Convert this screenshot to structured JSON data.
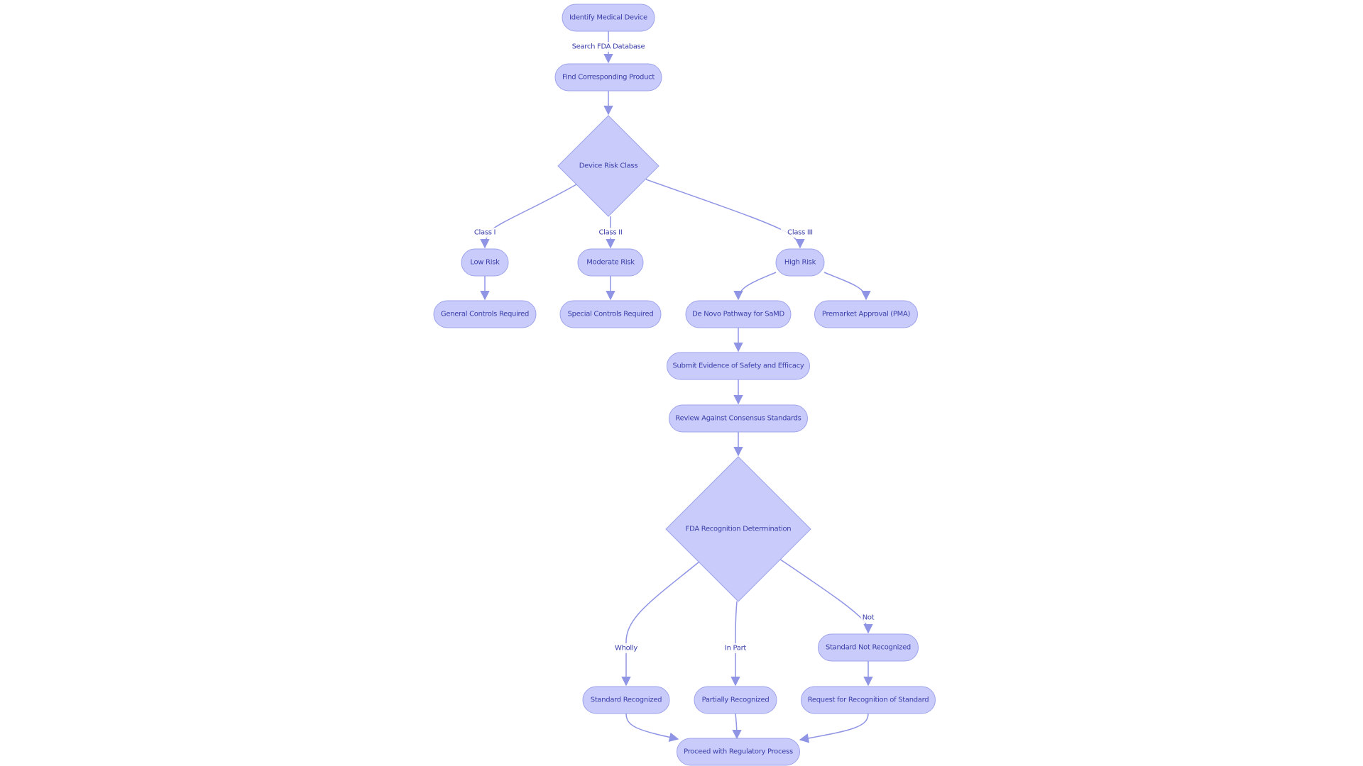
{
  "diagram": {
    "type": "flowchart",
    "colors": {
      "node_fill": "#c9ccfb",
      "node_stroke": "#9ea3ea",
      "text": "#3a3ea8",
      "edge": "#8f94e4",
      "background": "#ffffff"
    },
    "nodes": {
      "identify": {
        "label": "Identify Medical Device",
        "shape": "stadium"
      },
      "find": {
        "label": "Find Corresponding Product",
        "shape": "stadium"
      },
      "risk_class": {
        "label": "Device Risk Class",
        "shape": "diamond"
      },
      "low": {
        "label": "Low Risk",
        "shape": "stadium"
      },
      "moderate": {
        "label": "Moderate Risk",
        "shape": "stadium"
      },
      "high": {
        "label": "High Risk",
        "shape": "stadium"
      },
      "general": {
        "label": "General Controls Required",
        "shape": "stadium"
      },
      "special": {
        "label": "Special Controls Required",
        "shape": "stadium"
      },
      "denovo": {
        "label": "De Novo Pathway for SaMD",
        "shape": "stadium"
      },
      "pma": {
        "label": "Premarket Approval (PMA)",
        "shape": "stadium"
      },
      "submit": {
        "label": "Submit Evidence of Safety and Efficacy",
        "shape": "stadium"
      },
      "review": {
        "label": "Review Against Consensus Standards",
        "shape": "stadium"
      },
      "fda_recog": {
        "label": "FDA Recognition Determination",
        "shape": "diamond"
      },
      "not_recog": {
        "label": "Standard Not Recognized",
        "shape": "stadium"
      },
      "std_recog": {
        "label": "Standard Recognized",
        "shape": "stadium"
      },
      "partial": {
        "label": "Partially Recognized",
        "shape": "stadium"
      },
      "request": {
        "label": "Request for Recognition of Standard",
        "shape": "stadium"
      },
      "proceed": {
        "label": "Proceed with Regulatory Process",
        "shape": "stadium"
      }
    },
    "edges": [
      {
        "from": "identify",
        "to": "find",
        "label": "Search FDA Database"
      },
      {
        "from": "find",
        "to": "risk_class",
        "label": ""
      },
      {
        "from": "risk_class",
        "to": "low",
        "label": "Class I"
      },
      {
        "from": "risk_class",
        "to": "moderate",
        "label": "Class II"
      },
      {
        "from": "risk_class",
        "to": "high",
        "label": "Class III"
      },
      {
        "from": "low",
        "to": "general",
        "label": ""
      },
      {
        "from": "moderate",
        "to": "special",
        "label": ""
      },
      {
        "from": "high",
        "to": "denovo",
        "label": ""
      },
      {
        "from": "high",
        "to": "pma",
        "label": ""
      },
      {
        "from": "denovo",
        "to": "submit",
        "label": ""
      },
      {
        "from": "submit",
        "to": "review",
        "label": ""
      },
      {
        "from": "review",
        "to": "fda_recog",
        "label": ""
      },
      {
        "from": "fda_recog",
        "to": "std_recog",
        "label": "Wholly"
      },
      {
        "from": "fda_recog",
        "to": "partial",
        "label": "In Part"
      },
      {
        "from": "fda_recog",
        "to": "not_recog",
        "label": "Not"
      },
      {
        "from": "not_recog",
        "to": "request",
        "label": ""
      },
      {
        "from": "std_recog",
        "to": "proceed",
        "label": ""
      },
      {
        "from": "partial",
        "to": "proceed",
        "label": ""
      },
      {
        "from": "request",
        "to": "proceed",
        "label": ""
      }
    ]
  }
}
